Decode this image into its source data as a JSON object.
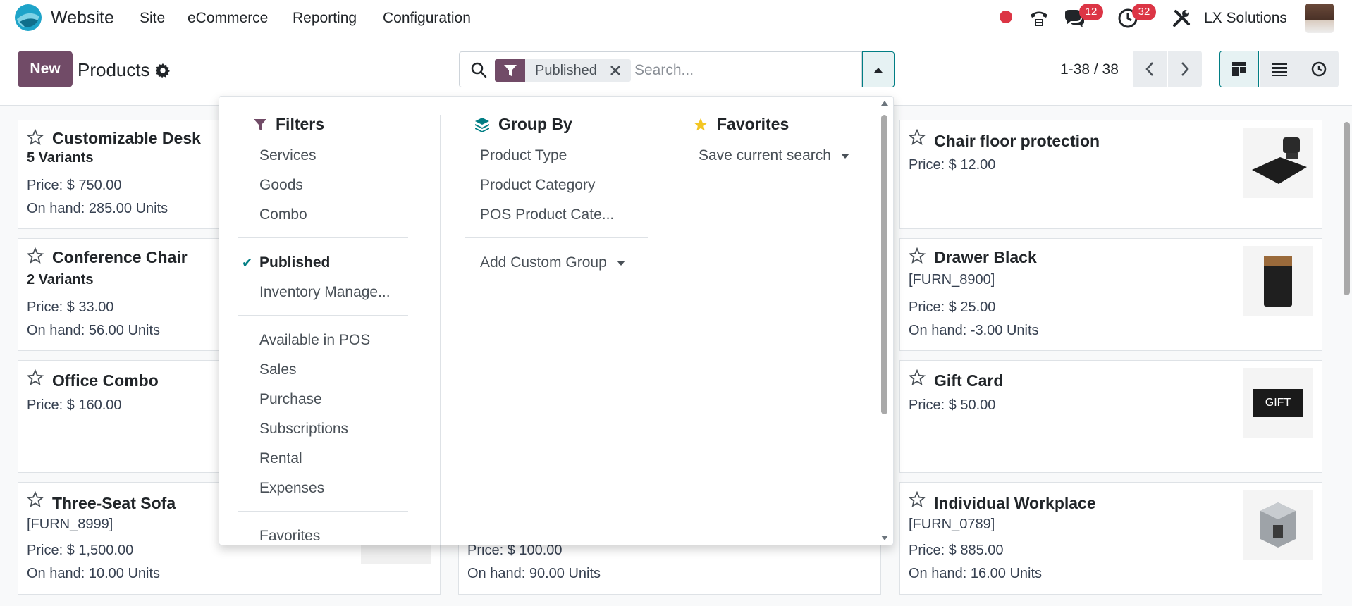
{
  "navbar": {
    "app_name": "Website",
    "menu": [
      "Site",
      "eCommerce",
      "Reporting",
      "Configuration"
    ],
    "messages_count": "12",
    "activities_count": "32",
    "company": "LX Solutions"
  },
  "control_panel": {
    "new_label": "New",
    "title": "Products",
    "facet_label": "Published",
    "search_placeholder": "Search...",
    "pager": "1-38 / 38"
  },
  "dropdown": {
    "filters": {
      "title": "Filters",
      "group1": [
        "Services",
        "Goods",
        "Combo"
      ],
      "group2": [
        "Published",
        "Inventory Manage..."
      ],
      "group3": [
        "Available in POS",
        "Sales",
        "Purchase",
        "Subscriptions",
        "Rental",
        "Expenses"
      ],
      "group4_partial": "Favorites"
    },
    "group_by": {
      "title": "Group By",
      "items": [
        "Product Type",
        "Product Category",
        "POS Product Cate..."
      ],
      "custom": "Add Custom Group"
    },
    "favorites": {
      "title": "Favorites",
      "save": "Save current search"
    }
  },
  "kanban": {
    "left": [
      {
        "title": "Customizable Desk",
        "sub": "5 Variants",
        "price": "Price: $ 750.00",
        "onhand": "On hand: 285.00 Units"
      },
      {
        "title": "Conference Chair",
        "sub": "2 Variants",
        "price": "Price: $ 33.00",
        "onhand": "On hand: 56.00 Units"
      },
      {
        "title": "Office Combo",
        "price": "Price: $ 160.00"
      },
      {
        "title": "Three-Seat Sofa",
        "sub": "[FURN_8999]",
        "price": "Price: $ 1,500.00",
        "onhand": "On hand: 10.00 Units"
      }
    ],
    "middle_visible": {
      "price": "Price: $ 100.00",
      "onhand": "On hand: 90.00 Units"
    },
    "right": [
      {
        "title": "Chair floor protection",
        "price": "Price: $ 12.00"
      },
      {
        "title": "Drawer Black",
        "sub": "[FURN_8900]",
        "price": "Price: $ 25.00",
        "onhand": "On hand: -3.00 Units"
      },
      {
        "title": "Gift Card",
        "price": "Price: $ 50.00",
        "image_text": "GIFT"
      },
      {
        "title": "Individual Workplace",
        "sub": "[FURN_0789]",
        "price": "Price: $ 885.00",
        "onhand": "On hand: 16.00 Units"
      }
    ]
  },
  "colors": {
    "brand": "#714b67",
    "accent": "#017e84",
    "badge": "#dc3545"
  }
}
